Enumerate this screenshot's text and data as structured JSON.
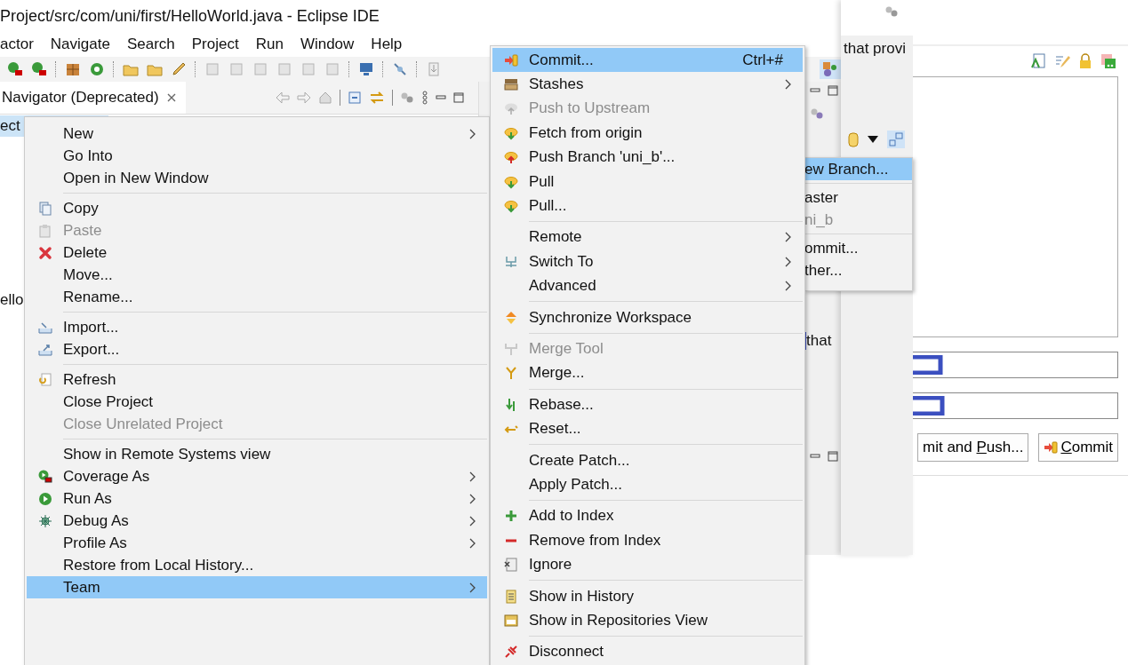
{
  "window": {
    "title": "Project/src/com/uni/first/HelloWorld.java - Eclipse IDE"
  },
  "menubar": [
    "actor",
    "Navigate",
    "Search",
    "Project",
    "Run",
    "Window",
    "Help"
  ],
  "navigator": {
    "tab": "Navigator (Deprecated)",
    "tree": [
      {
        "label": "ect",
        "selected": true
      },
      {
        "label": "ello",
        "selected": false
      }
    ]
  },
  "context_menu": {
    "items": [
      {
        "kind": "plain",
        "label": "New",
        "submenu": true,
        "disabled": false,
        "selected": false
      },
      {
        "kind": "plain",
        "label": "Go Into",
        "submenu": false,
        "disabled": false,
        "selected": false
      },
      {
        "kind": "plain",
        "label": "Open in New Window",
        "submenu": false,
        "disabled": false,
        "selected": false
      },
      {
        "kind": "separator"
      },
      {
        "kind": "copy",
        "label": "Copy",
        "submenu": false,
        "disabled": false,
        "selected": false
      },
      {
        "kind": "paste",
        "label": "Paste",
        "submenu": false,
        "disabled": true,
        "selected": false
      },
      {
        "kind": "delete",
        "label": "Delete",
        "submenu": false,
        "disabled": false,
        "selected": false
      },
      {
        "kind": "plain",
        "label": "Move...",
        "submenu": false,
        "disabled": false,
        "selected": false
      },
      {
        "kind": "plain",
        "label": "Rename...",
        "submenu": false,
        "disabled": false,
        "selected": false
      },
      {
        "kind": "separator"
      },
      {
        "kind": "import",
        "label": "Import...",
        "submenu": false,
        "disabled": false,
        "selected": false
      },
      {
        "kind": "export",
        "label": "Export...",
        "submenu": false,
        "disabled": false,
        "selected": false
      },
      {
        "kind": "separator"
      },
      {
        "kind": "refresh",
        "label": "Refresh",
        "submenu": false,
        "disabled": false,
        "selected": false
      },
      {
        "kind": "plain",
        "label": "Close Project",
        "submenu": false,
        "disabled": false,
        "selected": false
      },
      {
        "kind": "plain",
        "label": "Close Unrelated Project",
        "submenu": false,
        "disabled": true,
        "selected": false
      },
      {
        "kind": "separator"
      },
      {
        "kind": "plain",
        "label": "Show in Remote Systems view",
        "submenu": false,
        "disabled": false,
        "selected": false
      },
      {
        "kind": "coverage",
        "label": "Coverage As",
        "submenu": true,
        "disabled": false,
        "selected": false
      },
      {
        "kind": "run",
        "label": "Run As",
        "submenu": true,
        "disabled": false,
        "selected": false
      },
      {
        "kind": "debug",
        "label": "Debug As",
        "submenu": true,
        "disabled": false,
        "selected": false
      },
      {
        "kind": "plain",
        "label": "Profile As",
        "submenu": true,
        "disabled": false,
        "selected": false
      },
      {
        "kind": "plain",
        "label": "Restore from Local History...",
        "submenu": false,
        "disabled": false,
        "selected": false
      },
      {
        "kind": "plain",
        "label": "Team",
        "submenu": true,
        "disabled": false,
        "selected": true
      }
    ]
  },
  "team_menu": {
    "items": [
      {
        "kind": "commit",
        "label": "Commit...",
        "shortcut": "Ctrl+#",
        "submenu": false,
        "disabled": false,
        "selected": true
      },
      {
        "kind": "stash",
        "label": "Stashes",
        "submenu": true,
        "disabled": false,
        "selected": false
      },
      {
        "kind": "upstream",
        "label": "Push to Upstream",
        "submenu": false,
        "disabled": true,
        "selected": false
      },
      {
        "kind": "fetch",
        "label": "Fetch from origin",
        "submenu": false,
        "disabled": false,
        "selected": false
      },
      {
        "kind": "push",
        "label": "Push Branch 'uni_b'...",
        "submenu": false,
        "disabled": false,
        "selected": false
      },
      {
        "kind": "pull",
        "label": "Pull",
        "submenu": false,
        "disabled": false,
        "selected": false
      },
      {
        "kind": "pull-dialog",
        "label": "Pull...",
        "submenu": false,
        "disabled": false,
        "selected": false
      },
      {
        "kind": "separator"
      },
      {
        "kind": "plain",
        "label": "Remote",
        "submenu": true,
        "disabled": false,
        "selected": false
      },
      {
        "kind": "switch",
        "label": "Switch To",
        "submenu": true,
        "disabled": false,
        "selected": false
      },
      {
        "kind": "plain",
        "label": "Advanced",
        "submenu": true,
        "disabled": false,
        "selected": false
      },
      {
        "kind": "separator"
      },
      {
        "kind": "sync",
        "label": "Synchronize Workspace",
        "submenu": false,
        "disabled": false,
        "selected": false
      },
      {
        "kind": "separator"
      },
      {
        "kind": "merge-tool",
        "label": "Merge Tool",
        "submenu": false,
        "disabled": true,
        "selected": false
      },
      {
        "kind": "merge",
        "label": "Merge...",
        "submenu": false,
        "disabled": false,
        "selected": false
      },
      {
        "kind": "separator"
      },
      {
        "kind": "rebase",
        "label": "Rebase...",
        "submenu": false,
        "disabled": false,
        "selected": false
      },
      {
        "kind": "reset",
        "label": "Reset...",
        "submenu": false,
        "disabled": false,
        "selected": false
      },
      {
        "kind": "separator"
      },
      {
        "kind": "plain",
        "label": "Create Patch...",
        "submenu": false,
        "disabled": false,
        "selected": false
      },
      {
        "kind": "plain",
        "label": "Apply Patch...",
        "submenu": false,
        "disabled": false,
        "selected": false
      },
      {
        "kind": "separator"
      },
      {
        "kind": "add",
        "label": "Add to Index",
        "submenu": false,
        "disabled": false,
        "selected": false
      },
      {
        "kind": "remove",
        "label": "Remove from Index",
        "submenu": false,
        "disabled": false,
        "selected": false
      },
      {
        "kind": "ignore",
        "label": "Ignore",
        "submenu": false,
        "disabled": false,
        "selected": false
      },
      {
        "kind": "separator"
      },
      {
        "kind": "history",
        "label": "Show in History",
        "submenu": false,
        "disabled": false,
        "selected": false
      },
      {
        "kind": "repos",
        "label": "Show in Repositories View",
        "submenu": false,
        "disabled": false,
        "selected": false
      },
      {
        "kind": "separator"
      },
      {
        "kind": "disconnect",
        "label": "Disconnect",
        "submenu": false,
        "disabled": false,
        "selected": false
      }
    ]
  },
  "switch_menu": {
    "items": [
      {
        "kind": "item",
        "label": "ew Branch...",
        "disabled": false,
        "selected": true
      },
      {
        "kind": "separator"
      },
      {
        "kind": "item",
        "label": "aster",
        "disabled": false,
        "selected": false
      },
      {
        "kind": "item",
        "label": "ni_b",
        "disabled": true,
        "selected": false
      },
      {
        "kind": "separator"
      },
      {
        "kind": "item",
        "label": "ommit...",
        "disabled": false,
        "selected": false
      },
      {
        "kind": "item",
        "label": "ther...",
        "disabled": false,
        "selected": false
      }
    ]
  },
  "side_panel": {
    "texts": [
      "that provi",
      "that"
    ]
  },
  "commit_dialog": {
    "buttons": [
      {
        "before": "mit and ",
        "key": "P",
        "after": "ush...",
        "kind": "plain"
      },
      {
        "key": "C",
        "after": "ommit",
        "kind": "commit"
      }
    ]
  }
}
